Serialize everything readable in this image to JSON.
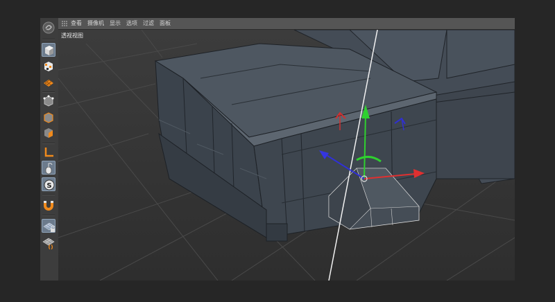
{
  "menu": {
    "items": [
      "查看",
      "摄像机",
      "显示",
      "选项",
      "过滤",
      "面板"
    ]
  },
  "viewport": {
    "label": "透视视图"
  },
  "toolbar": {
    "tools": [
      {
        "name": "undo-logo-icon",
        "active": false
      },
      {
        "name": "model-mode-icon",
        "active": true
      },
      {
        "name": "object-mode-icon",
        "active": false
      },
      {
        "name": "texture-mode-icon",
        "active": false
      },
      {
        "name": "points-mode-icon",
        "active": false
      },
      {
        "name": "edges-mode-icon",
        "active": false
      },
      {
        "name": "polygons-mode-icon",
        "active": false
      },
      {
        "name": "axis-mode-icon",
        "active": false
      },
      {
        "name": "tweak-mode-icon",
        "active": false
      },
      {
        "name": "solo-mode-icon",
        "active": false
      },
      {
        "name": "snap-magnet-icon",
        "active": false
      },
      {
        "name": "workplane-lock-icon",
        "active": false
      },
      {
        "name": "workplane-icon",
        "active": false
      }
    ]
  },
  "colors": {
    "x_axis": "#e03030",
    "y_axis": "#2fd02f",
    "z_axis": "#3030d8",
    "accent_orange": "#f08a1c"
  }
}
